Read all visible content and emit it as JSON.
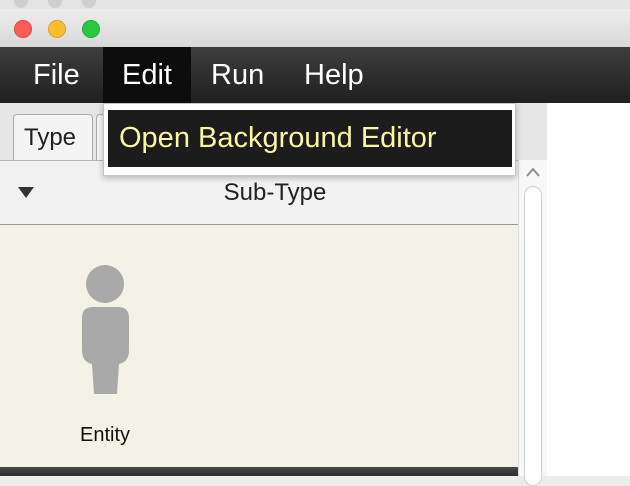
{
  "window": {
    "controls": [
      {
        "name": "close",
        "color": "#fd5d57"
      },
      {
        "name": "minimize",
        "color": "#fdbd2e"
      },
      {
        "name": "zoom",
        "color": "#28c940"
      }
    ]
  },
  "menubar": {
    "items": [
      {
        "label": "File"
      },
      {
        "label": "Edit",
        "active": true
      },
      {
        "label": "Run"
      },
      {
        "label": "Help"
      }
    ]
  },
  "edit_menu": {
    "items": [
      {
        "label": "Open Background Editor",
        "highlighted": true
      }
    ],
    "highlight_bg": "#1c1c1c",
    "highlight_fg": "#fbf6a4"
  },
  "tabs": [
    {
      "label": "Type",
      "selected": true
    },
    {
      "label": ""
    }
  ],
  "panel": {
    "header": "Sub-Type",
    "collapse_icon": "triangle-down-icon",
    "background": "#f4f2e6",
    "items": [
      {
        "label": "Entity",
        "icon": "person-icon"
      }
    ]
  }
}
